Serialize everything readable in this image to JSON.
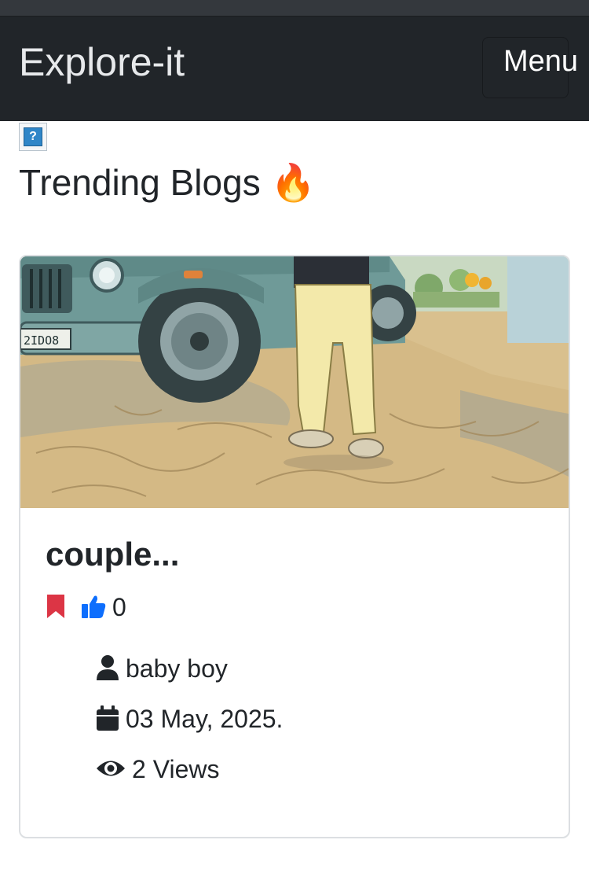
{
  "navbar": {
    "brand": "Explore-it",
    "menu_label": "Menu"
  },
  "broken_image_glyph": "?",
  "section": {
    "title": "Trending Blogs 🔥"
  },
  "post": {
    "title": "couple...",
    "likes": "0",
    "author": "baby boy",
    "date": "03 May, 2025.",
    "views": "2 Views",
    "plate_text": "2IDO8"
  },
  "colors": {
    "navbar_bg": "#212529",
    "bookmark": "#dc3545",
    "like": "#0d6efd",
    "text": "#212529"
  },
  "icons": [
    "question-icon",
    "bookmark-icon",
    "thumbs-up-icon",
    "user-icon",
    "calendar-icon",
    "eye-icon"
  ]
}
